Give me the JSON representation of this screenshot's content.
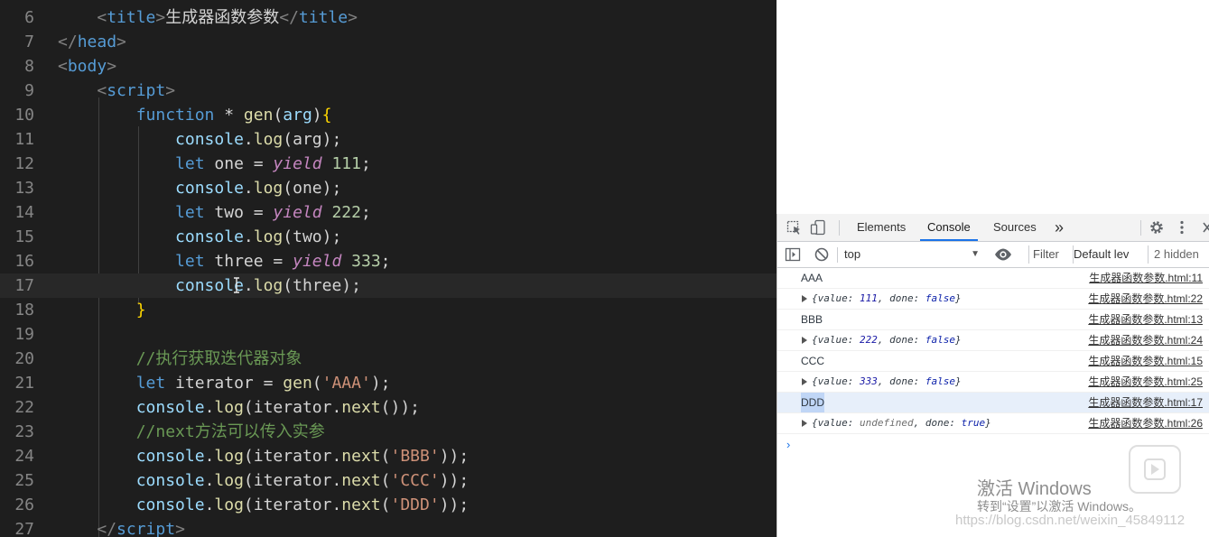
{
  "editor": {
    "lines": [
      {
        "n": "6",
        "tokens": [
          [
            "    ",
            "t-txt"
          ],
          [
            "<",
            "t-punct"
          ],
          [
            "title",
            "t-tag"
          ],
          [
            ">",
            "t-punct"
          ],
          [
            "生成器函数参数",
            "t-txt"
          ],
          [
            "</",
            "t-punct"
          ],
          [
            "title",
            "t-tag"
          ],
          [
            ">",
            "t-punct"
          ]
        ]
      },
      {
        "n": "7",
        "tokens": [
          [
            "</",
            "t-punct"
          ],
          [
            "head",
            "t-tag"
          ],
          [
            ">",
            "t-punct"
          ]
        ]
      },
      {
        "n": "8",
        "tokens": [
          [
            "<",
            "t-punct"
          ],
          [
            "body",
            "t-tag"
          ],
          [
            ">",
            "t-punct"
          ]
        ]
      },
      {
        "n": "9",
        "tokens": [
          [
            "    ",
            "t-txt"
          ],
          [
            "<",
            "t-punct"
          ],
          [
            "script",
            "t-tag"
          ],
          [
            ">",
            "t-punct"
          ]
        ]
      },
      {
        "n": "10",
        "tokens": [
          [
            "        ",
            "t-txt"
          ],
          [
            "function",
            "t-kw"
          ],
          [
            " * ",
            "t-op"
          ],
          [
            "gen",
            "t-fn"
          ],
          [
            "(",
            "t-txt"
          ],
          [
            "arg",
            "t-param"
          ],
          [
            ")",
            "t-txt"
          ],
          [
            "{",
            "t-brace"
          ]
        ]
      },
      {
        "n": "11",
        "tokens": [
          [
            "            ",
            "t-txt"
          ],
          [
            "console",
            "t-var"
          ],
          [
            ".",
            "t-txt"
          ],
          [
            "log",
            "t-fn"
          ],
          [
            "(arg);",
            "t-txt"
          ]
        ]
      },
      {
        "n": "12",
        "tokens": [
          [
            "            ",
            "t-txt"
          ],
          [
            "let",
            "t-kw"
          ],
          [
            " one = ",
            "t-txt"
          ],
          [
            "yield",
            "t-yield"
          ],
          [
            " ",
            "t-txt"
          ],
          [
            "111",
            "t-num"
          ],
          [
            ";",
            "t-txt"
          ]
        ]
      },
      {
        "n": "13",
        "tokens": [
          [
            "            ",
            "t-txt"
          ],
          [
            "console",
            "t-var"
          ],
          [
            ".",
            "t-txt"
          ],
          [
            "log",
            "t-fn"
          ],
          [
            "(one);",
            "t-txt"
          ]
        ]
      },
      {
        "n": "14",
        "tokens": [
          [
            "            ",
            "t-txt"
          ],
          [
            "let",
            "t-kw"
          ],
          [
            " two = ",
            "t-txt"
          ],
          [
            "yield",
            "t-yield"
          ],
          [
            " ",
            "t-txt"
          ],
          [
            "222",
            "t-num"
          ],
          [
            ";",
            "t-txt"
          ]
        ]
      },
      {
        "n": "15",
        "tokens": [
          [
            "            ",
            "t-txt"
          ],
          [
            "console",
            "t-var"
          ],
          [
            ".",
            "t-txt"
          ],
          [
            "log",
            "t-fn"
          ],
          [
            "(two);",
            "t-txt"
          ]
        ]
      },
      {
        "n": "16",
        "tokens": [
          [
            "            ",
            "t-txt"
          ],
          [
            "let",
            "t-kw"
          ],
          [
            " three = ",
            "t-txt"
          ],
          [
            "yield",
            "t-yield"
          ],
          [
            " ",
            "t-txt"
          ],
          [
            "333",
            "t-num"
          ],
          [
            ";",
            "t-txt"
          ]
        ]
      },
      {
        "n": "17",
        "tokens": [
          [
            "            ",
            "t-txt"
          ],
          [
            "console",
            "t-var"
          ],
          [
            ".",
            "t-txt"
          ],
          [
            "log",
            "t-fn"
          ],
          [
            "(three);",
            "t-txt"
          ]
        ],
        "current": true
      },
      {
        "n": "18",
        "tokens": [
          [
            "        ",
            "t-txt"
          ],
          [
            "}",
            "t-brace"
          ]
        ]
      },
      {
        "n": "19",
        "tokens": []
      },
      {
        "n": "20",
        "tokens": [
          [
            "        ",
            "t-txt"
          ],
          [
            "//执行获取迭代器对象",
            "t-com"
          ]
        ]
      },
      {
        "n": "21",
        "tokens": [
          [
            "        ",
            "t-txt"
          ],
          [
            "let",
            "t-kw"
          ],
          [
            " iterator = ",
            "t-txt"
          ],
          [
            "gen",
            "t-fn"
          ],
          [
            "(",
            "t-txt"
          ],
          [
            "'AAA'",
            "t-str"
          ],
          [
            ");",
            "t-txt"
          ]
        ]
      },
      {
        "n": "22",
        "tokens": [
          [
            "        ",
            "t-txt"
          ],
          [
            "console",
            "t-var"
          ],
          [
            ".",
            "t-txt"
          ],
          [
            "log",
            "t-fn"
          ],
          [
            "(iterator.",
            "t-txt"
          ],
          [
            "next",
            "t-fn"
          ],
          [
            "());",
            "t-txt"
          ]
        ]
      },
      {
        "n": "23",
        "tokens": [
          [
            "        ",
            "t-txt"
          ],
          [
            "//next方法可以传入实参",
            "t-com"
          ]
        ]
      },
      {
        "n": "24",
        "tokens": [
          [
            "        ",
            "t-txt"
          ],
          [
            "console",
            "t-var"
          ],
          [
            ".",
            "t-txt"
          ],
          [
            "log",
            "t-fn"
          ],
          [
            "(iterator.",
            "t-txt"
          ],
          [
            "next",
            "t-fn"
          ],
          [
            "(",
            "t-txt"
          ],
          [
            "'BBB'",
            "t-str"
          ],
          [
            "));",
            "t-txt"
          ]
        ]
      },
      {
        "n": "25",
        "tokens": [
          [
            "        ",
            "t-txt"
          ],
          [
            "console",
            "t-var"
          ],
          [
            ".",
            "t-txt"
          ],
          [
            "log",
            "t-fn"
          ],
          [
            "(iterator.",
            "t-txt"
          ],
          [
            "next",
            "t-fn"
          ],
          [
            "(",
            "t-txt"
          ],
          [
            "'CCC'",
            "t-str"
          ],
          [
            "));",
            "t-txt"
          ]
        ]
      },
      {
        "n": "26",
        "tokens": [
          [
            "        ",
            "t-txt"
          ],
          [
            "console",
            "t-var"
          ],
          [
            ".",
            "t-txt"
          ],
          [
            "log",
            "t-fn"
          ],
          [
            "(iterator.",
            "t-txt"
          ],
          [
            "next",
            "t-fn"
          ],
          [
            "(",
            "t-txt"
          ],
          [
            "'DDD'",
            "t-str"
          ],
          [
            "));",
            "t-txt"
          ]
        ]
      },
      {
        "n": "27",
        "tokens": [
          [
            "    ",
            "t-txt"
          ],
          [
            "</",
            "t-punct"
          ],
          [
            "script",
            "t-tag"
          ],
          [
            ">",
            "t-punct"
          ]
        ]
      }
    ]
  },
  "devtools": {
    "tabs": [
      "Elements",
      "Console",
      "Sources"
    ],
    "active_tab": "Console",
    "more_tabs": "»",
    "context": "top",
    "filter_placeholder": "Filter",
    "levels": "Default lev",
    "hidden": "2 hidden",
    "accent_color": "#1a73e8",
    "messages": [
      {
        "kind": "text",
        "text": "AAA",
        "src": "生成器函数参数.html:11"
      },
      {
        "kind": "obj",
        "value": "111",
        "done": "false",
        "src": "生成器函数参数.html:22"
      },
      {
        "kind": "text",
        "text": "BBB",
        "src": "生成器函数参数.html:13"
      },
      {
        "kind": "obj",
        "value": "222",
        "done": "false",
        "src": "生成器函数参数.html:24"
      },
      {
        "kind": "text",
        "text": "CCC",
        "src": "生成器函数参数.html:15"
      },
      {
        "kind": "obj",
        "value": "333",
        "done": "false",
        "src": "生成器函数参数.html:25"
      },
      {
        "kind": "text",
        "text": "DDD",
        "src": "生成器函数参数.html:17",
        "selected": true
      },
      {
        "kind": "obj",
        "value": "undefined",
        "done": "true",
        "src": "生成器函数参数.html:26"
      }
    ],
    "prompt": "›"
  },
  "watermark": {
    "title": "激活 Windows",
    "subtitle": "转到“设置”以激活 Windows。",
    "url": "https://blog.csdn.net/weixin_45849112"
  }
}
